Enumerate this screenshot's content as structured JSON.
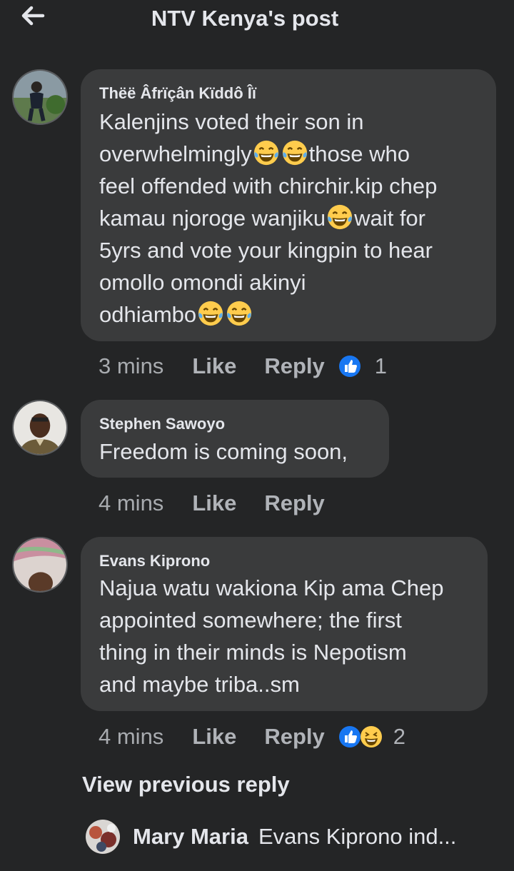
{
  "header": {
    "title": "NTV Kenya's post",
    "back_icon": "arrow-left-icon"
  },
  "comments": [
    {
      "author": "Thëë Âfrïçân Kïddô Îï",
      "text_lines": [
        "Kalenjins voted their son in",
        "overwhelmingly",
        "those who",
        "feel offended with chirchir.kip chep",
        "kamau njoroge wanjiku",
        "wait for",
        "5yrs and vote your kingpin to hear",
        "omollo omondi akinyi",
        "odhiambo"
      ],
      "time": "3 mins",
      "like_label": "Like",
      "reply_label": "Reply",
      "reactions": [
        "like"
      ],
      "reaction_count": "1"
    },
    {
      "author": "Stephen Sawoyo",
      "text_lines": [
        "Freedom is coming soon,"
      ],
      "time": "4 mins",
      "like_label": "Like",
      "reply_label": "Reply"
    },
    {
      "author": "Evans Kiprono",
      "text_lines": [
        "Najua watu wakiona Kip ama Chep",
        "appointed somewhere;  the first",
        "thing in their minds is Nepotism",
        "and maybe triba..sm"
      ],
      "time": "4 mins",
      "like_label": "Like",
      "reply_label": "Reply",
      "reactions": [
        "like",
        "haha"
      ],
      "reaction_count": "2"
    }
  ],
  "view_previous_reply": "View previous reply",
  "reply_preview": {
    "author": "Mary Maria",
    "snippet": "Evans Kiprono ind..."
  },
  "colors": {
    "background": "#242526",
    "bubble": "#3a3b3c",
    "text": "#e4e6eb",
    "muted": "#b0b3b8",
    "like_blue": "#1877f2",
    "emoji_yellow": "#ffcc4d"
  }
}
